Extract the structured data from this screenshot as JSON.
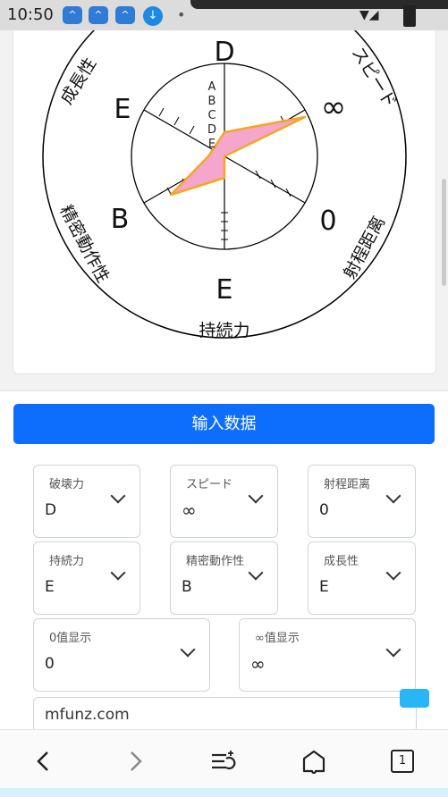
{
  "status": {
    "time": "10:50",
    "notif1": "^",
    "notif2": "^",
    "notif3": "^",
    "download": "↓",
    "dot": "•"
  },
  "radar": {
    "top_label": "D",
    "upper_right": "∞",
    "lower_right": "0",
    "bottom_label": "E",
    "lower_left": "B",
    "upper_left": "E",
    "axis_names": {
      "top_left": "成長性",
      "top_right": "スピード",
      "right": "射程距离",
      "bottom": "持続力",
      "left": "精密動作性"
    },
    "scale": [
      "A",
      "B",
      "C",
      "D",
      "E"
    ]
  },
  "actions": {
    "input_button": "输入数据"
  },
  "fields": {
    "destroy": {
      "label": "破壊力",
      "value": "D"
    },
    "speed": {
      "label": "スピード",
      "value": "∞"
    },
    "range": {
      "label": "射程距离",
      "value": "0"
    },
    "endurance": {
      "label": "持続力",
      "value": "E"
    },
    "precision": {
      "label": "精密動作性",
      "value": "B"
    },
    "growth": {
      "label": "成長性",
      "value": "E"
    },
    "zero_display": {
      "label": "0值显示",
      "value": "0"
    },
    "inf_display": {
      "label": "∞值显示",
      "value": "∞"
    }
  },
  "watermark": "mfunz.com",
  "navbar": {
    "tab_count": "1"
  },
  "colors": {
    "accent": "#0d6efd",
    "polygon_fill": "#f4a6cd",
    "polygon_stroke": "#f5a623"
  }
}
